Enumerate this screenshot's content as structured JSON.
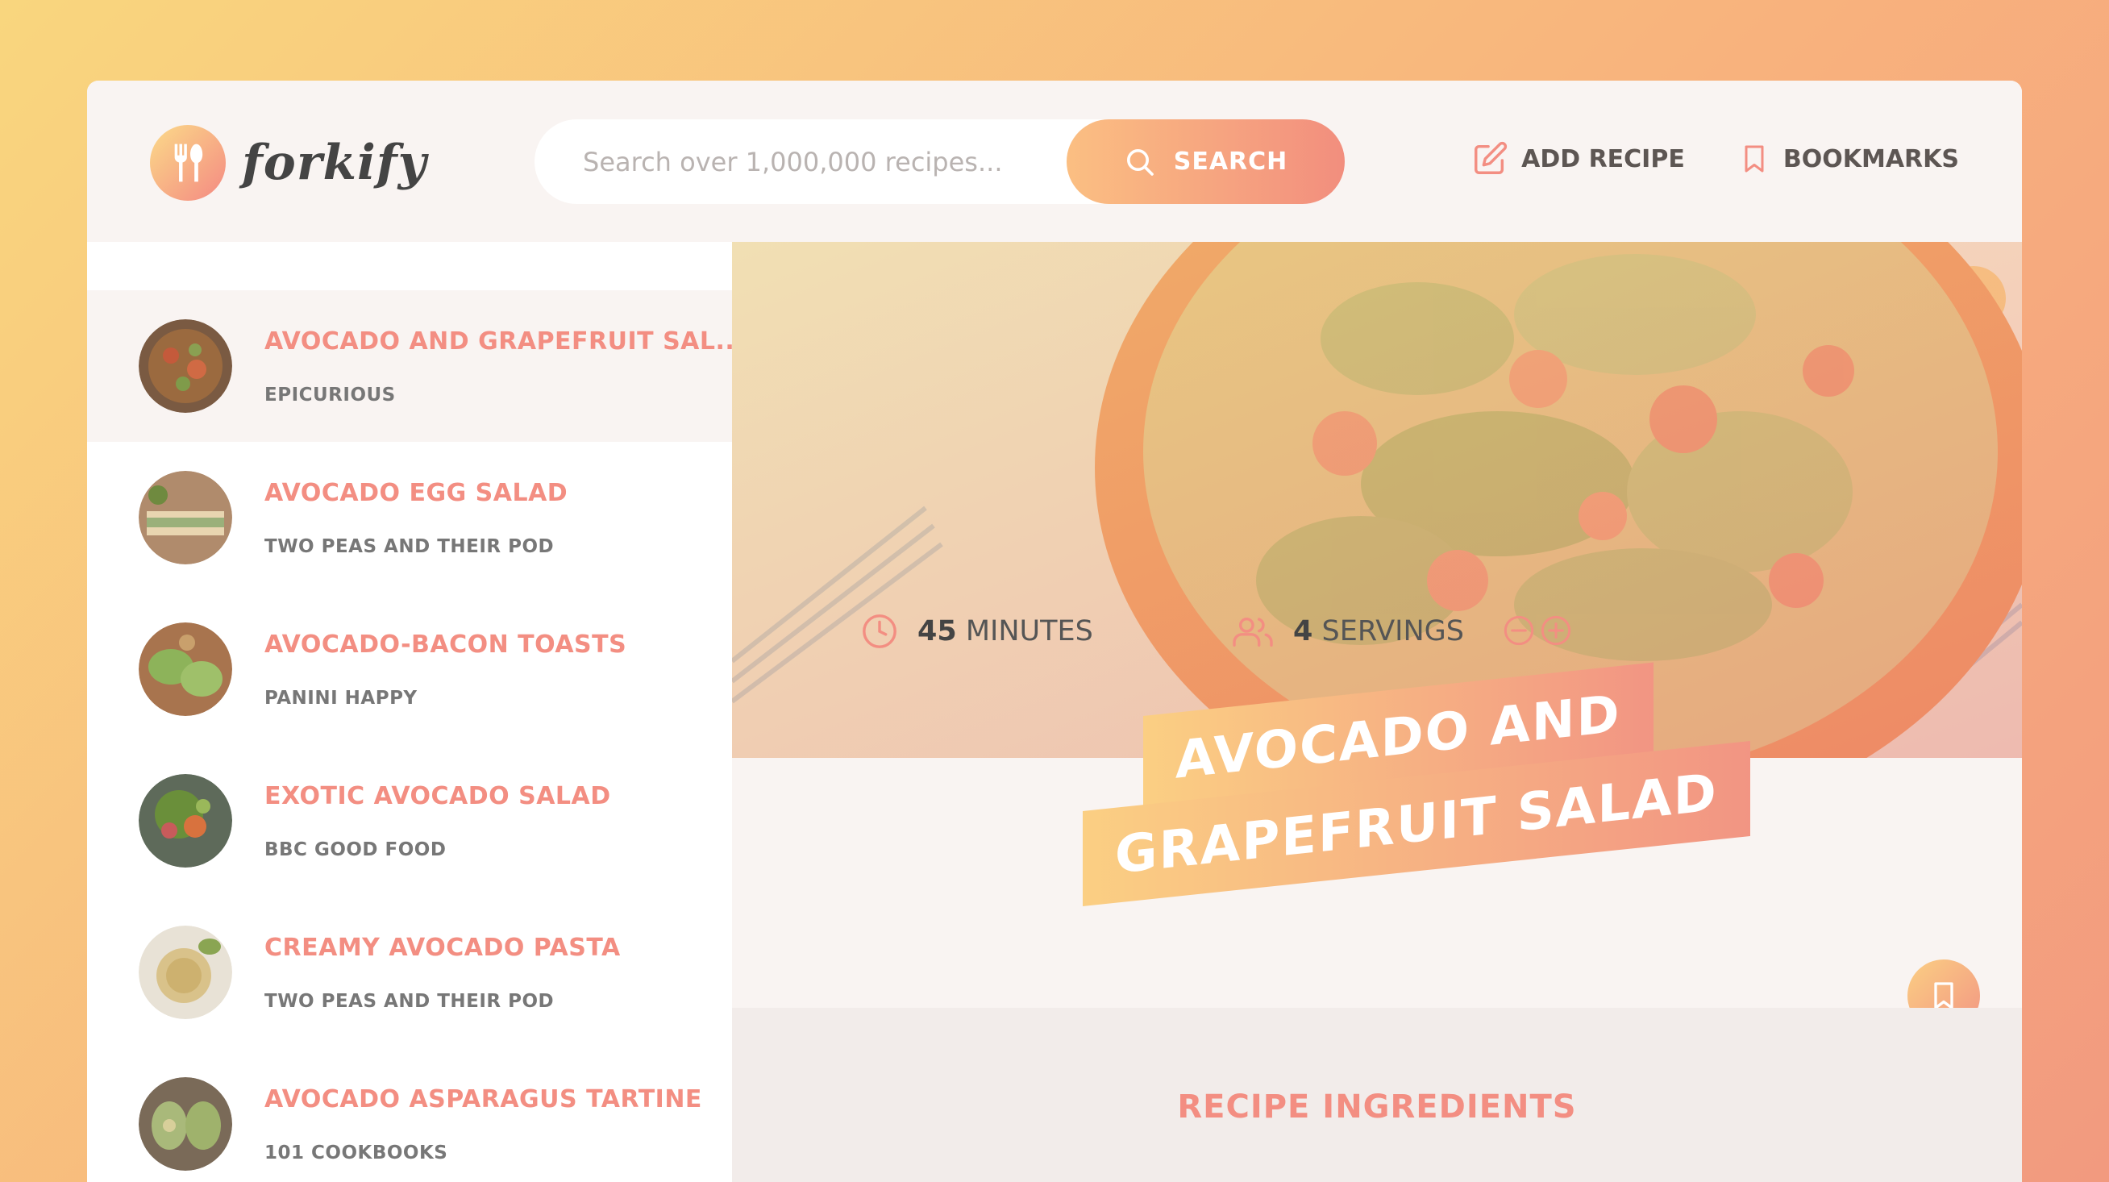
{
  "app": {
    "name": "forkify"
  },
  "search": {
    "placeholder": "Search over 1,000,000 recipes...",
    "button_label": "SEARCH"
  },
  "nav": {
    "add_recipe": "ADD RECIPE",
    "bookmarks": "BOOKMARKS"
  },
  "results": [
    {
      "title": "AVOCADO AND GRAPEFRUIT SAL...",
      "publisher": "EPICURIOUS",
      "active": true
    },
    {
      "title": "AVOCADO EGG SALAD",
      "publisher": "TWO PEAS AND THEIR POD"
    },
    {
      "title": "AVOCADO-BACON TOASTS",
      "publisher": "PANINI HAPPY"
    },
    {
      "title": "EXOTIC AVOCADO SALAD",
      "publisher": "BBC GOOD FOOD"
    },
    {
      "title": "CREAMY AVOCADO PASTA",
      "publisher": "TWO PEAS AND THEIR POD"
    },
    {
      "title": "AVOCADO ASPARAGUS TARTINE",
      "publisher": "101 COOKBOOKS"
    }
  ],
  "recipe": {
    "title_line1": "AVOCADO AND",
    "title_line2": "GRAPEFRUIT SALAD",
    "minutes": "45",
    "minutes_label": "MINUTES",
    "servings": "4",
    "servings_label": "SERVINGS",
    "ingredients_heading": "RECIPE INGREDIENTS"
  },
  "colors": {
    "accent": "#f38e82",
    "accent_light": "#fbcf83",
    "bg": "#f9f4f2"
  }
}
